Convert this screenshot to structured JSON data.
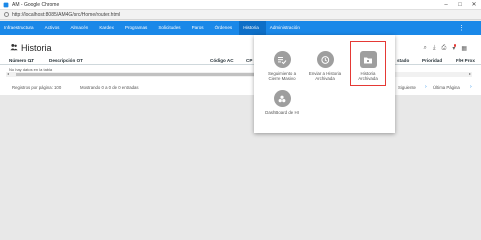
{
  "browser": {
    "window_title": "AM - Google Chrome",
    "url": "http://localhost:8085/AM4G/src/Home/router.html"
  },
  "navbar": {
    "items": [
      "Infraestructura",
      "Activos",
      "Almacén",
      "Kardex",
      "Programas",
      "Solicitudes",
      "Paros",
      "Órdenes",
      "Historia",
      "Administración"
    ],
    "active": "Historia"
  },
  "page": {
    "title": "Historia",
    "columns": [
      "Número OT",
      "Descripción OT",
      "Código AC",
      "CP",
      "stado",
      "Prioridad",
      "F/H Prox"
    ],
    "empty_message": "No hay datos en la tabla",
    "footer": {
      "page_size_label": "Registros por página: 100",
      "range_text": "Mostrando 0 a 0 de 0 entradas",
      "next_label": "Siguiente",
      "last_label": "Última Página"
    }
  },
  "menu_popup": {
    "tiles": [
      {
        "label_line1": "Seguimiento a",
        "label_line2": "Cierre Masivo",
        "icon": "playlist-check-icon"
      },
      {
        "label_line1": "Enviar a Historia",
        "label_line2": "Archivada",
        "icon": "history-icon"
      },
      {
        "label_line1": "Historia",
        "label_line2": "Archivada",
        "icon": "folder-archive-icon"
      },
      {
        "label_line1": "DashBoard de HI",
        "label_line2": "",
        "icon": "bubble-chart-icon"
      }
    ],
    "highlighted": "Historia Archivada",
    "highlight_color": "#e53935",
    "icon_circle_color": "#9e9e9e",
    "nav_color": "#1a88e8"
  }
}
